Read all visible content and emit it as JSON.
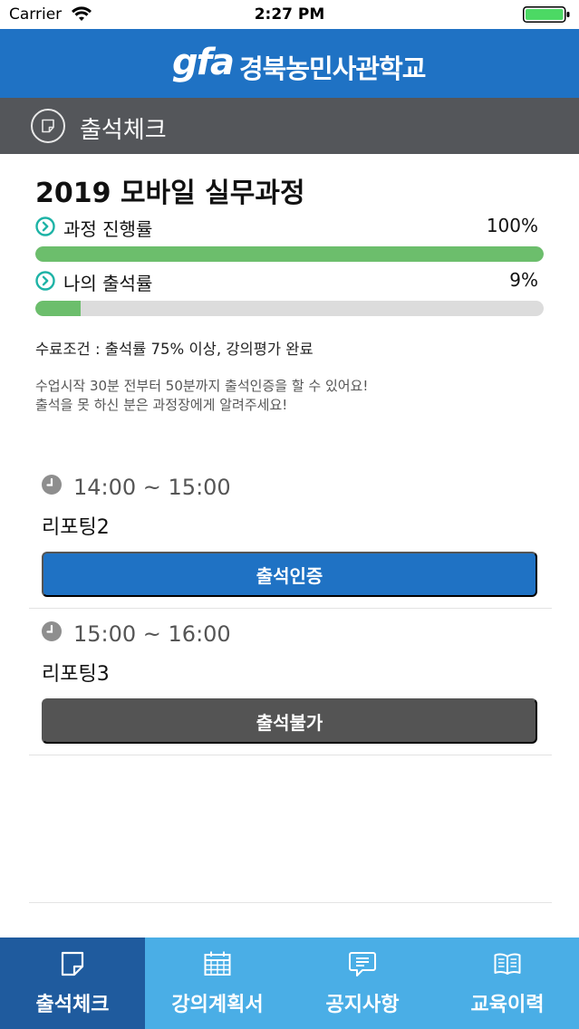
{
  "status_bar": {
    "carrier": "Carrier",
    "time": "2:27 PM",
    "battery_color": "#4cd964"
  },
  "header": {
    "logo_mark": "gfa",
    "logo_text": "경북농민사관학교",
    "background": "#1f72c4"
  },
  "title_bar": {
    "title": "출석체크",
    "icon": "note-icon"
  },
  "course": {
    "title": "2019 모바일 실무과정",
    "progress": {
      "label": "과정 진행률",
      "value_text": "100%",
      "fraction": 1.0
    },
    "attendance": {
      "label": "나의 출석률",
      "value_text": "9%",
      "fraction": 0.09
    },
    "completion_condition": "수료조건 : 출석률 75% 이상, 강의평가 완료",
    "notice_lines": [
      "수업시작 30분 전부터 50분까지 출석인증을 할 수 있어요!",
      "출석을 못 하신 분은 과정장에게 알려주세요!"
    ]
  },
  "sessions": [
    {
      "time": "14:00 ~ 15:00",
      "name": "리포팅2",
      "button_label": "출석인증",
      "enabled": true
    },
    {
      "time": "15:00 ~ 16:00",
      "name": "리포팅3",
      "button_label": "출석불가",
      "enabled": false
    }
  ],
  "tabs": [
    {
      "label": "출석체크",
      "icon": "note-icon",
      "selected": true
    },
    {
      "label": "강의계획서",
      "icon": "calendar-icon",
      "selected": false
    },
    {
      "label": "공지사항",
      "icon": "speech-bubble-icon",
      "selected": false
    },
    {
      "label": "교육이력",
      "icon": "open-book-icon",
      "selected": false
    }
  ],
  "colors": {
    "accent": "#1f72c4",
    "progress_fill": "#6cbe6c",
    "metric_icon": "#1db3a6",
    "tab_bar": "#4aaee6",
    "tab_selected": "#1f5b9e"
  }
}
